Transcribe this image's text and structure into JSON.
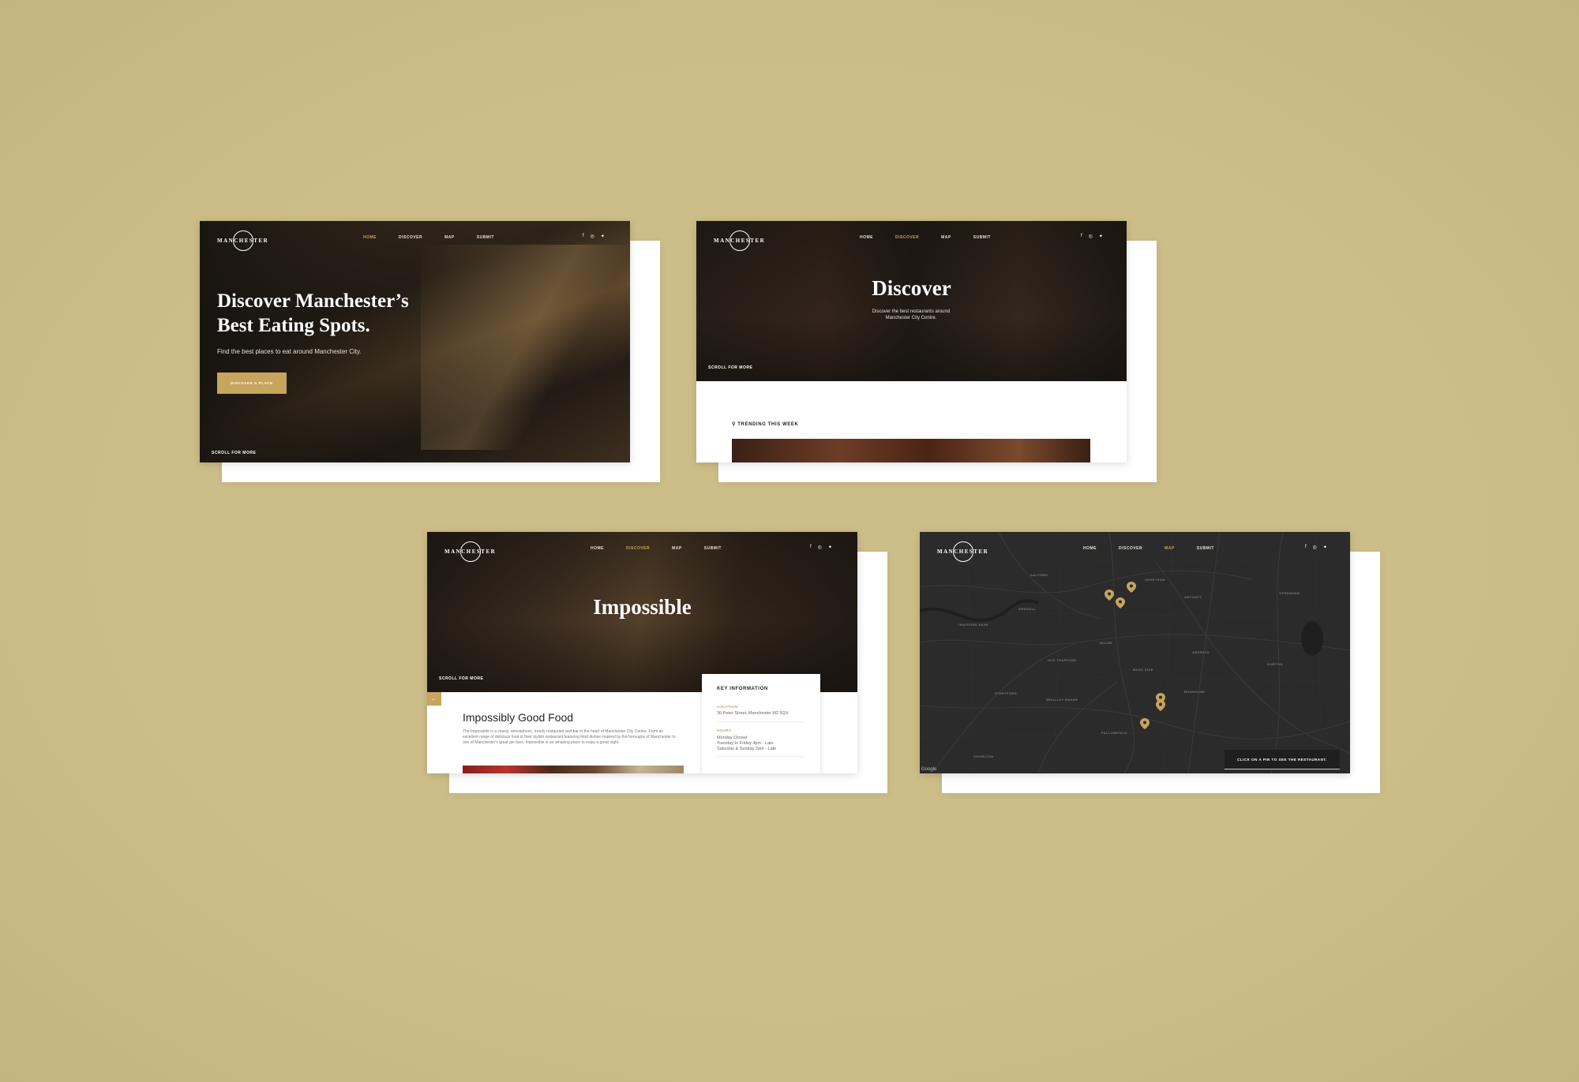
{
  "brand": {
    "logo_text": "MANCHESTER"
  },
  "colors": {
    "background": "#cdbe89",
    "accent": "#c6a55c",
    "dark": "#1f1c19"
  },
  "icons": {
    "facebook": "facebook-icon",
    "instagram": "instagram-icon",
    "twitter": "twitter-icon",
    "pin": "map-pin-icon"
  },
  "nav": {
    "home": "HOME",
    "discover": "DISCOVER",
    "map": "MAP",
    "submit": "SUBMIT"
  },
  "scroll_more": "SCROLL FOR MORE",
  "home": {
    "title_line1": "Discover Manchester’s",
    "title_line2": "Best Eating Spots.",
    "subtitle": "Find the best places to eat around Manchester City.",
    "cta": "DISCOVER A PLACE"
  },
  "discover": {
    "title": "Discover",
    "subtitle": "Discover the best restaurants around Manchester City Centre.",
    "trending": "TRENDING THIS WEEK"
  },
  "restaurant": {
    "title": "Impossible",
    "heading": "Impossibly Good Food",
    "body": "The Impossible is a classy, atmospheric, trendy restaurant and bar in the heart of Manchester City Centre. From an excellent range of delicious food in their stylish restaurant featuring food dishes inspired by the boroughs of Manchester to one of Manchester's great gin bars, Impossible is an amazing place to enjoy a great night.",
    "key_info": "KEY INFORMATION",
    "location_label": "LOCATION",
    "location_value": "36 Peter Street, Manchester M2 5QX",
    "hours_label": "HOURS",
    "hours_line1": "Monday Closed",
    "hours_line2": "Tuesday to Friday 4pm - Late",
    "hours_line3": "Saturday & Sunday 2pm - Late"
  },
  "map": {
    "cta": "CLICK ON A PIN TO SEE THE RESTAURANT.",
    "attribution": "Google",
    "labels": {
      "salford": "SALFORD",
      "trafford_park": "TRAFFORD PARK",
      "old_trafford": "OLD TRAFFORD",
      "hulme": "HULME",
      "ancoats": "ANCOATS",
      "ardwick": "ARDWICK",
      "moss_side": "MOSS SIDE",
      "rusholme": "RUSHOLME",
      "stretford": "STRETFORD",
      "chorlton": "CHORLTON",
      "whalley_range": "WHALLEY RANGE",
      "cheetham": "CHEETHAM",
      "openshaw": "OPENSHAW",
      "ordsall": "ORDSALL",
      "gorton": "GORTON",
      "fallowfield": "FALLOWFIELD"
    }
  }
}
